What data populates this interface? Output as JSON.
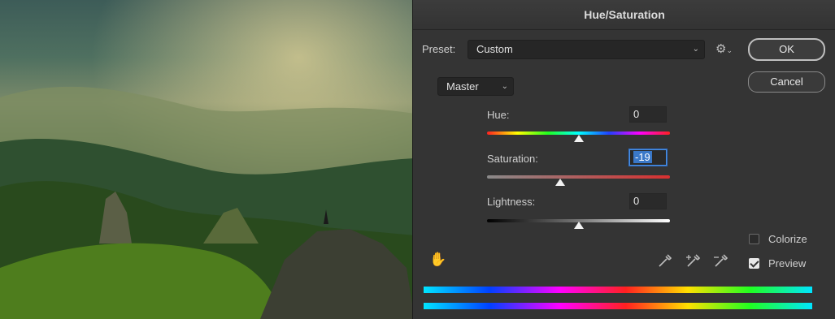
{
  "dialog": {
    "title": "Hue/Saturation",
    "preset_label": "Preset:",
    "preset_value": "Custom",
    "ok_label": "OK",
    "cancel_label": "Cancel",
    "channel_value": "Master",
    "hue": {
      "label": "Hue:",
      "value": "0"
    },
    "saturation": {
      "label": "Saturation:",
      "value": "-19"
    },
    "lightness": {
      "label": "Lightness:",
      "value": "0"
    },
    "colorize_label": "Colorize",
    "colorize_checked": false,
    "preview_label": "Preview",
    "preview_checked": true
  },
  "icons": [
    "gear-icon",
    "hand-adjust-icon",
    "eyedropper-icon",
    "eyedropper-plus-icon",
    "eyedropper-minus-icon"
  ],
  "colors": {
    "dialog_bg": "#343434",
    "field_bg": "#262626",
    "focus": "#3a78c8"
  }
}
